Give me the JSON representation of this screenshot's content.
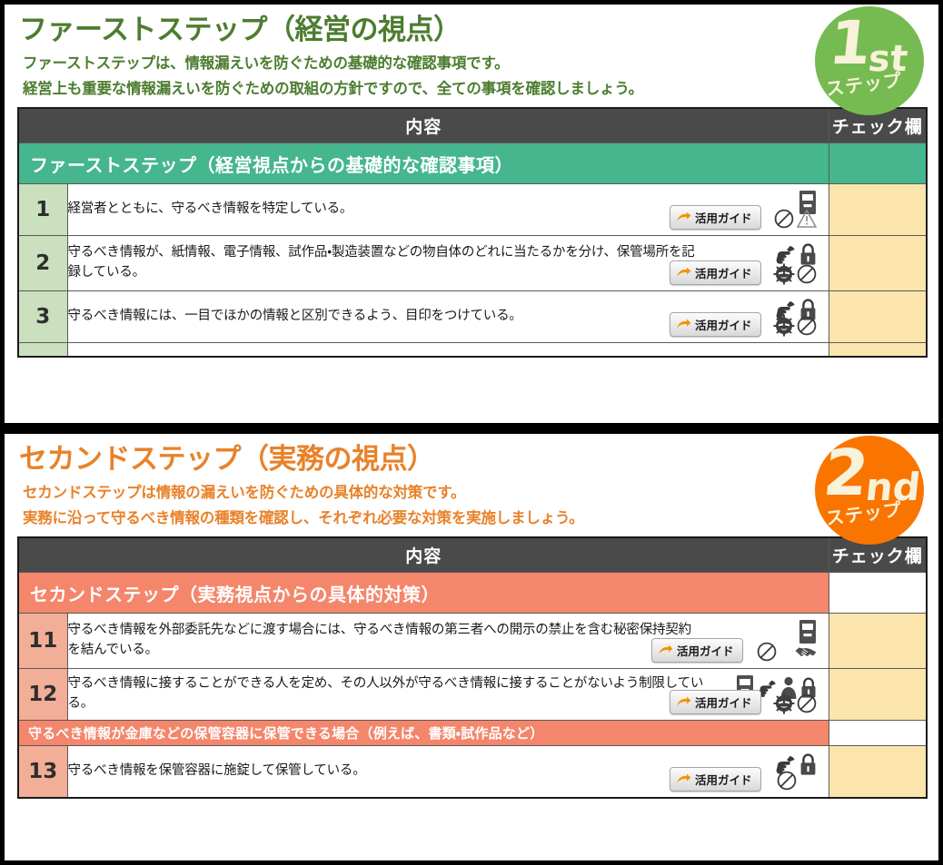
{
  "panels": [
    {
      "step_key": "first",
      "title": "ファーストステップ（経営の視点）",
      "lead1": "ファーストステップは、情報漏えいを防ぐための基礎的な確認事項です。",
      "lead2": "経営上も重要な情報漏えいを防ぐための取組の方針ですので、全ての事項を確認しましょう。",
      "accent_color": "#4c7d2f",
      "badge": {
        "number": "1",
        "suffix": "st",
        "label": "ステップ",
        "color": "#76bb51"
      },
      "table": {
        "header_content": "内容",
        "header_check": "チェック欄",
        "section_label": "ファーストステップ（経営視点からの基礎的な確認事項）",
        "section_color": "#45b68e",
        "num_cell_color": "#cbe0be",
        "check_cell_color": "#fce5ac",
        "guide_label": "活用ガイド",
        "rows": [
          {
            "no": "1",
            "text": "経営者とともに、守るべき情報を特定している。",
            "icons_top": [
              "cabinet-icon"
            ],
            "icons_bottom": [
              "prohibition-icon",
              "warning-icon"
            ]
          },
          {
            "no": "2",
            "text": "守るべき情報が、紙情報、電子情報、試作品・製造装置などの物自体のどれに当たるかを分け、保管場所を記録している。",
            "icons_top": [
              "pointing-hand-icon",
              "padlock-icon"
            ],
            "icons_bottom": [
              "burglar-face-icon",
              "prohibition-icon"
            ]
          },
          {
            "no": "3",
            "text": "守るべき情報には、一目でほかの情報と区別できるよう、目印をつけている。",
            "icons_top": [
              "pointing-hand-icon",
              "padlock-icon"
            ],
            "icons_bottom": [
              "burglar-face-icon",
              "prohibition-icon"
            ]
          }
        ]
      }
    },
    {
      "step_key": "second",
      "title": "セカンドステップ（実務の視点）",
      "lead1": "セカンドステップは情報の漏えいを防ぐための具体的な対策です。",
      "lead2": "実務に沿って守るべき情報の種類を確認し、それぞれ必要な対策を実施しましょう。",
      "accent_color": "#e8822a",
      "badge": {
        "number": "2",
        "suffix": "nd",
        "label": "ステップ",
        "color": "#fa7500"
      },
      "table": {
        "header_content": "内容",
        "header_check": "チェック欄",
        "section_label": "セカンドステップ（実務視点からの具体的対策）",
        "section_color": "#f4866b",
        "num_cell_color": "#f2ae97",
        "check_cell_color": "#fce5ac",
        "guide_label": "活用ガイド",
        "sub_section_label": "守るべき情報が金庫などの保管容器に保管できる場合（例えば、書類・試作品など）",
        "rows": [
          {
            "no": "11",
            "text": "守るべき情報を外部委託先などに渡す場合には、守るべき情報の第三者への開示の禁止を含む秘密保持契約を結んでいる。",
            "icons_top": [
              "cabinet-icon"
            ],
            "icons_bottom": [
              "prohibition-icon",
              "handshake-icon"
            ]
          },
          {
            "no": "12",
            "text": "守るべき情報に接することができる人を定め、その人以外が守るべき情報に接することがないよう制限している。",
            "icons_top": [
              "cabinet-icon",
              "pointing-hand-icon",
              "person-icon",
              "padlock-icon"
            ],
            "icons_bottom": [
              "burglar-face-icon",
              "prohibition-icon"
            ]
          },
          {
            "no": "13",
            "text": "守るべき情報を保管容器に施錠して保管している。",
            "icons_top": [
              "pointing-hand-icon",
              "padlock-icon"
            ],
            "icons_bottom": [
              "prohibition-icon"
            ]
          }
        ]
      }
    }
  ]
}
